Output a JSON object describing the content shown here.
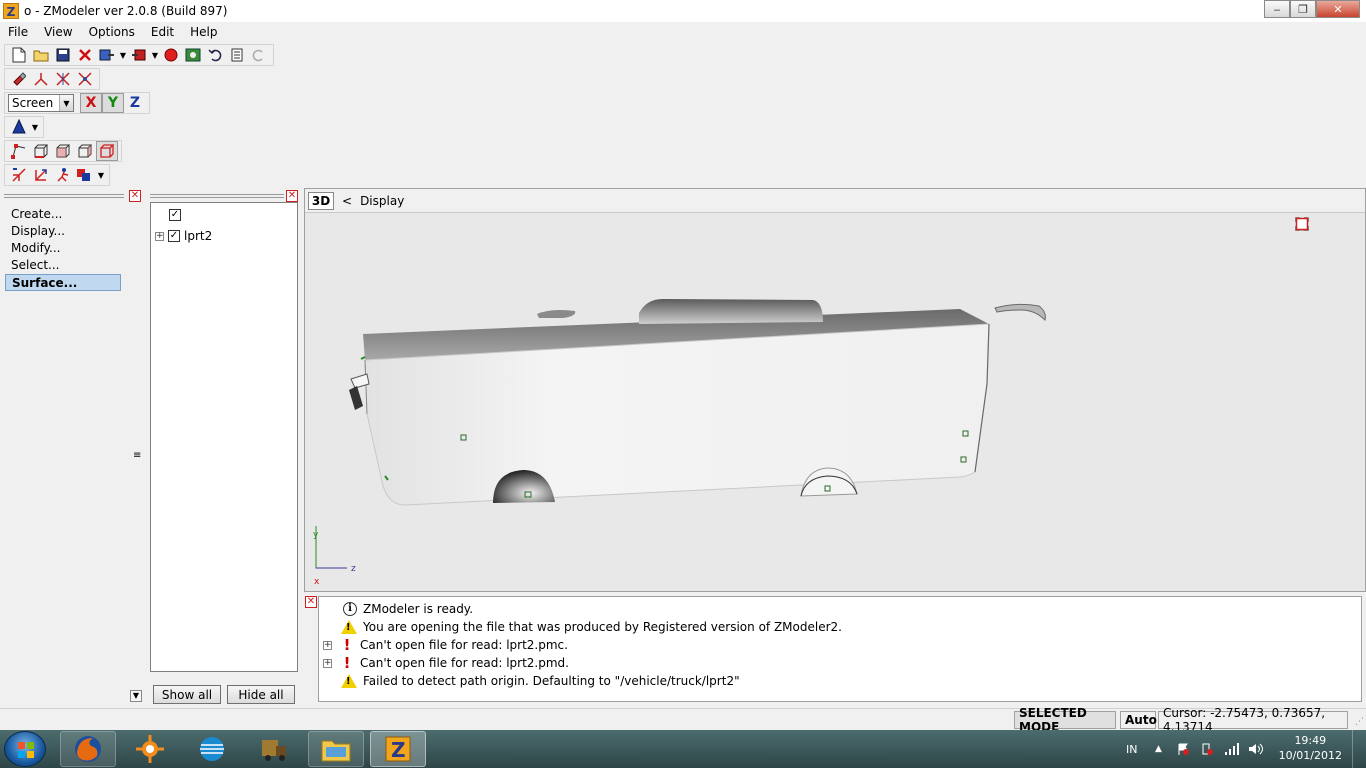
{
  "window": {
    "title": "o - ZModeler ver 2.0.8 (Build 897)",
    "app_icon_letter": "Z",
    "minimize": "‒",
    "maximize": "❐",
    "close": "✕"
  },
  "menu": [
    "File",
    "View",
    "Options",
    "Edit",
    "Help"
  ],
  "toolbar": {
    "coord_system": "Screen",
    "axes": [
      "X",
      "Y",
      "Z"
    ]
  },
  "command_panel": {
    "items": [
      "Create...",
      "Display...",
      "Modify...",
      "Select...",
      "Surface..."
    ],
    "active": "Surface..."
  },
  "hierarchy": {
    "nodes": [
      {
        "label": "",
        "checked": true,
        "expandable": false
      },
      {
        "label": "lprt2",
        "checked": true,
        "expandable": true
      }
    ],
    "show_all": "Show all",
    "hide_all": "Hide all"
  },
  "viewport": {
    "mode": "3D",
    "nav": "<",
    "title": "Display",
    "axis_y": "y",
    "axis_z": "z",
    "axis_x": "x"
  },
  "log": [
    {
      "type": "info",
      "text": "ZModeler is ready.",
      "expandable": false
    },
    {
      "type": "warning",
      "text": "You are opening the file that was produced by Registered version of ZModeler2.",
      "expandable": false
    },
    {
      "type": "error",
      "text": "Can't open file for read: lprt2.pmc.",
      "expandable": true
    },
    {
      "type": "error",
      "text": "Can't open file for read: lprt2.pmd.",
      "expandable": true
    },
    {
      "type": "warning",
      "text": "Failed to detect path origin. Defaulting to \"/vehicle/truck/lprt2\"",
      "expandable": false
    }
  ],
  "status": {
    "mode": "SELECTED MODE",
    "auto": "Auto",
    "cursor": "Cursor: -2.75473, 0.73657, 4.13714"
  },
  "taskbar": {
    "language": "IN",
    "time": "19:49",
    "date": "10/01/2012"
  },
  "colors": {
    "accent_selected": "#c0d8f0",
    "viewport_bg": "#e8e8e8",
    "taskbar": "#3a5658"
  }
}
